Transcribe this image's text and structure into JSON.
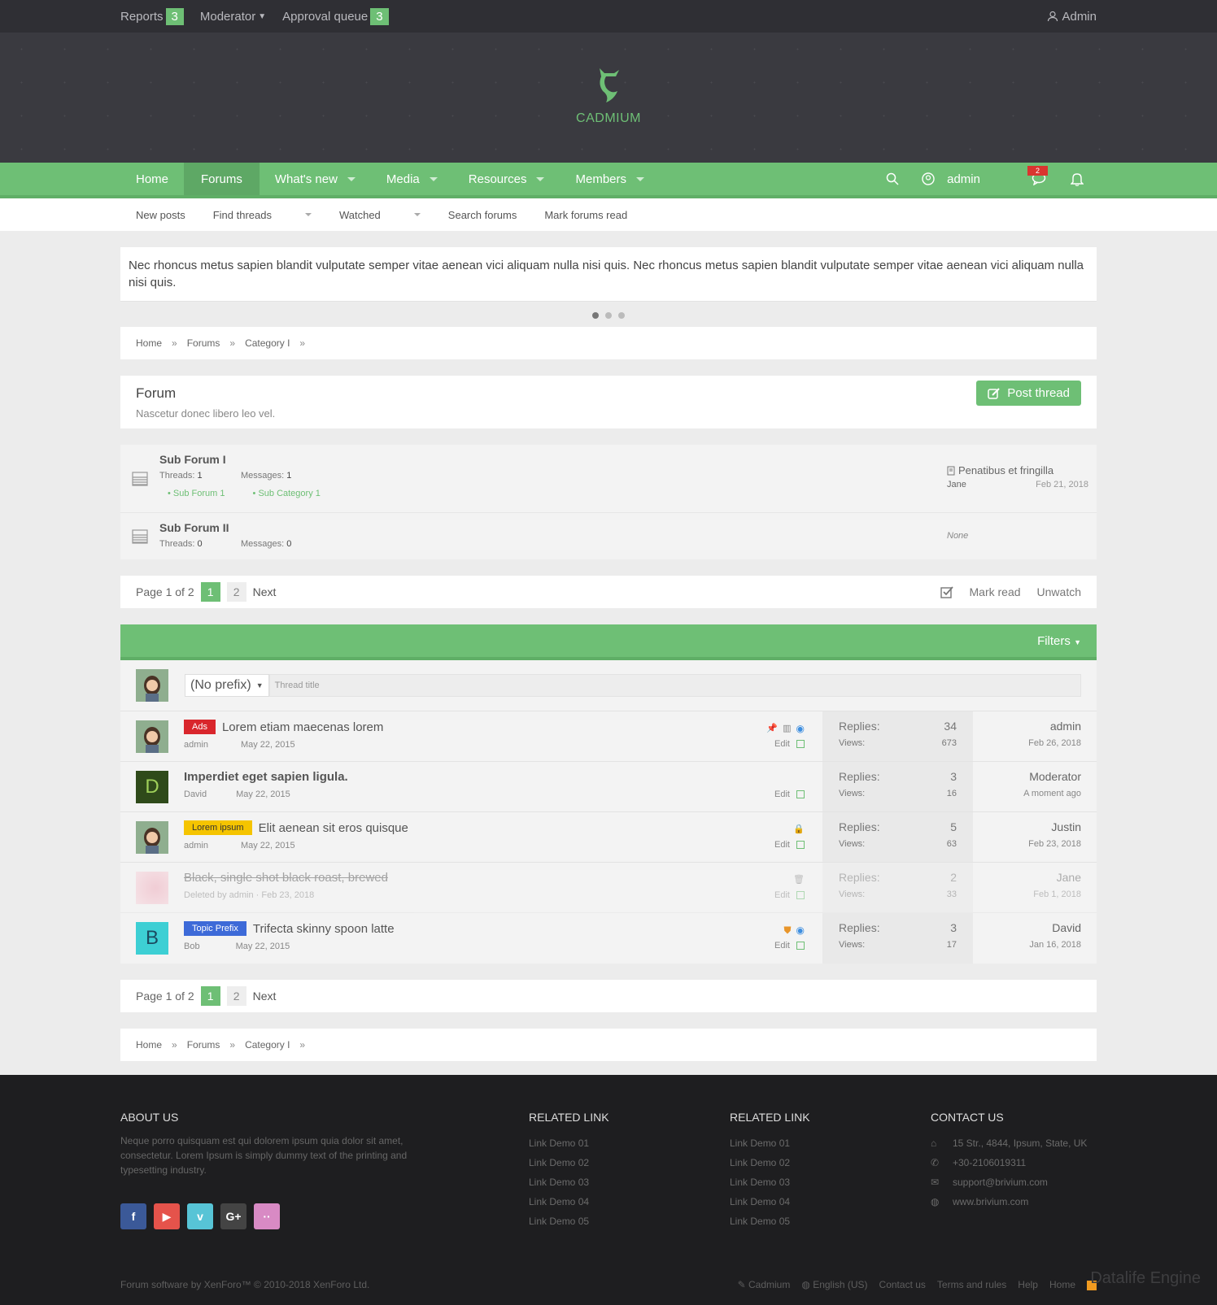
{
  "topbar": {
    "reports": "Reports",
    "reports_count": "3",
    "moderator": "Moderator",
    "approval": "Approval queue",
    "approval_count": "3",
    "admin": "Admin"
  },
  "logo": {
    "name": "CADMIUM"
  },
  "nav": {
    "items": [
      "Home",
      "Forums",
      "What's new",
      "Media",
      "Resources",
      "Members"
    ],
    "user": "admin",
    "conv_badge": "2"
  },
  "subnav": {
    "items": [
      "New posts",
      "Find threads",
      "Watched",
      "Search forums",
      "Mark forums read"
    ]
  },
  "notice": "Nec rhoncus metus sapien blandit vulputate semper vitae aenean vici aliquam nulla nisi quis. Nec rhoncus metus sapien blandit vulputate semper vitae aenean vici aliquam nulla nisi quis.",
  "breadcrumb": [
    "Home",
    "Forums",
    "Category I"
  ],
  "forum": {
    "title": "Forum",
    "desc": "Nascetur donec libero leo vel.",
    "post_thread": "Post thread"
  },
  "nodes": [
    {
      "title": "Sub Forum I",
      "threads_label": "Threads:",
      "threads": "1",
      "messages_label": "Messages:",
      "messages": "1",
      "subs": [
        "Sub Forum 1",
        "Sub Category 1"
      ],
      "last_title": "Penatibus et fringilla",
      "last_user": "Jane",
      "last_date": "Feb 21, 2018"
    },
    {
      "title": "Sub Forum II",
      "threads_label": "Threads:",
      "threads": "0",
      "messages_label": "Messages:",
      "messages": "0",
      "last_none": "None"
    }
  ],
  "pager": {
    "text": "Page 1 of 2",
    "p1": "1",
    "p2": "2",
    "next": "Next",
    "mark_read": "Mark read",
    "unwatch": "Unwatch"
  },
  "filters": "Filters",
  "quick": {
    "prefix": "(No prefix)",
    "placeholder": "Thread title"
  },
  "threads": [
    {
      "prefix": "Ads",
      "title": "Lorem etiam maecenas lorem",
      "author": "admin",
      "date": "May 22, 2015",
      "edit": "Edit",
      "replies_label": "Replies:",
      "replies": "34",
      "views_label": "Views:",
      "views": "673",
      "last_user": "admin",
      "last_date": "Feb 26, 2018"
    },
    {
      "title": "Imperdiet eget sapien ligula.",
      "author": "David",
      "date": "May 22, 2015",
      "edit": "Edit",
      "replies_label": "Replies:",
      "replies": "3",
      "views_label": "Views:",
      "views": "16",
      "last_user": "Moderator",
      "last_date": "A moment ago",
      "avatar_letter": "D"
    },
    {
      "prefix": "Lorem ipsum",
      "title": "Elit aenean sit eros quisque",
      "author": "admin",
      "date": "May 22, 2015",
      "edit": "Edit",
      "replies_label": "Replies:",
      "replies": "5",
      "views_label": "Views:",
      "views": "63",
      "last_user": "Justin",
      "last_date": "Feb 23, 2018"
    },
    {
      "title": "Black, single shot black roast, brewed",
      "deleted": "Deleted by admin · Feb 23, 2018",
      "edit": "Edit",
      "replies_label": "Replies:",
      "replies": "2",
      "views_label": "Views:",
      "views": "33",
      "last_user": "Jane",
      "last_date": "Feb 1, 2018"
    },
    {
      "prefix": "Topic Prefix",
      "title": "Trifecta skinny spoon latte",
      "author": "Bob",
      "date": "May 22, 2015",
      "edit": "Edit",
      "replies_label": "Replies:",
      "replies": "3",
      "views_label": "Views:",
      "views": "17",
      "last_user": "David",
      "last_date": "Jan 16, 2018",
      "avatar_letter": "B"
    }
  ],
  "footer": {
    "about_title": "ABOUT US",
    "about_text": "Neque porro quisquam est qui dolorem ipsum quia dolor sit amet, consectetur. Lorem Ipsum is simply dummy text of the printing and typesetting industry.",
    "related_title": "RELATED LINK",
    "links": [
      "Link Demo 01",
      "Link Demo 02",
      "Link Demo 03",
      "Link Demo 04",
      "Link Demo 05"
    ],
    "contact_title": "CONTACT US",
    "address": "15 Str., 4844, Ipsum, State, UK",
    "phone": "+30-2106019311",
    "email": "support@brivium.com",
    "web": "www.brivium.com",
    "copyright": "Forum software by XenForo™ © 2010-2018 XenForo Ltd.",
    "bottom_links": [
      "Cadmium",
      "English (US)",
      "Contact us",
      "Terms and rules",
      "Help",
      "Home"
    ],
    "watermark": "Datalife Engine"
  },
  "colors": {
    "accent": "#6ebf75",
    "ads": "#d9262c",
    "lorem": "#f5c400",
    "topic": "#3d6ad8"
  }
}
